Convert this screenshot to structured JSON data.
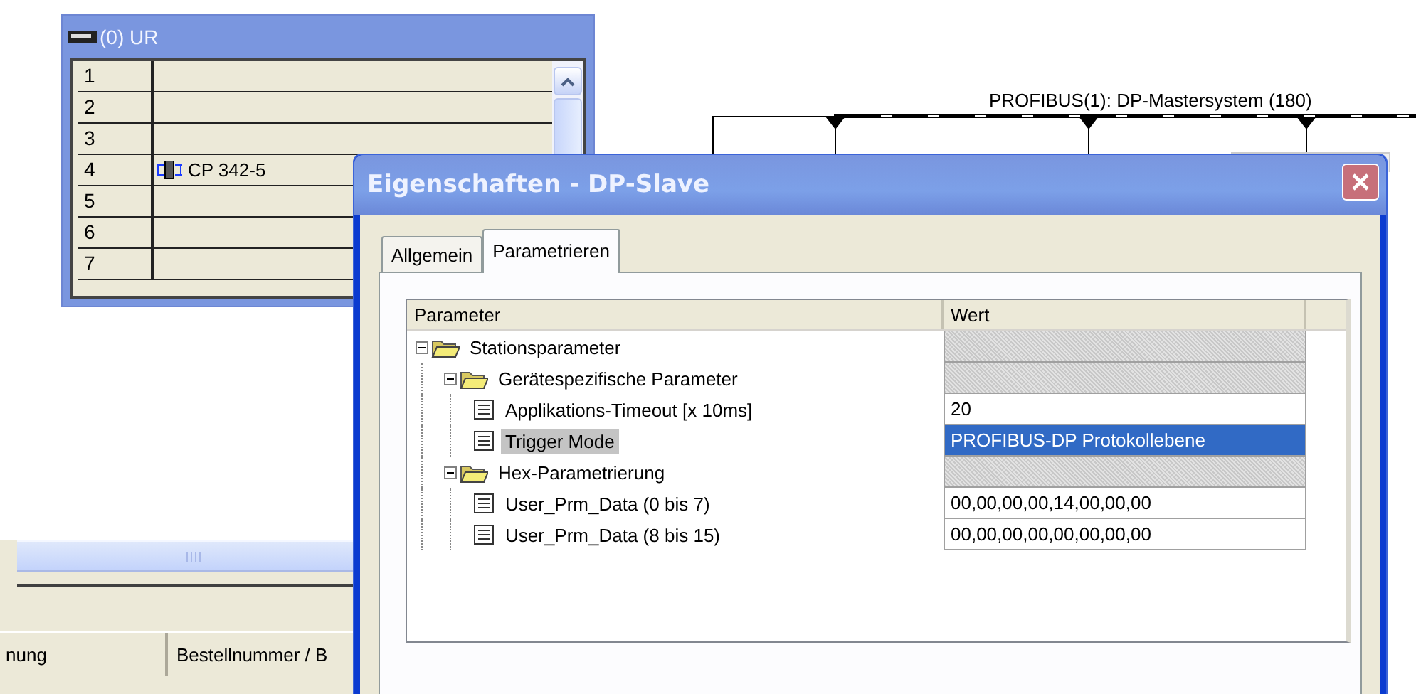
{
  "rack": {
    "title": "(0) UR",
    "rows": [
      {
        "slot": "1"
      },
      {
        "slot": "2"
      },
      {
        "slot": "3"
      },
      {
        "slot": "4",
        "module": "CP 342-5"
      },
      {
        "slot": "5"
      },
      {
        "slot": "6"
      },
      {
        "slot": "7"
      }
    ]
  },
  "bus": {
    "label": "PROFIBUS(1): DP-Mastersystem (180)"
  },
  "bottom_panel": {
    "columns": [
      "nung",
      "Bestellnummer / B"
    ]
  },
  "dialog": {
    "title": "Eigenschaften - DP-Slave",
    "tabs": [
      {
        "label": "Allgemein",
        "selected": false
      },
      {
        "label": "Parametrieren",
        "selected": true
      }
    ],
    "columns": [
      "Parameter",
      "Wert"
    ],
    "parameters": [
      {
        "name": "Stationsparameter",
        "expanded": true,
        "selected": false,
        "children": [
          {
            "name": "Gerätespezifische Parameter",
            "expanded": true,
            "selected": false,
            "children": [
              {
                "name": "Applikations-Timeout [x 10ms]",
                "value": "20",
                "selected": false
              },
              {
                "name": "Trigger Mode",
                "value": "PROFIBUS-DP Protokollebene",
                "selected": true
              }
            ]
          },
          {
            "name": "Hex-Parametrierung",
            "expanded": true,
            "selected": false,
            "children": [
              {
                "name": "User_Prm_Data (0 bis 7)",
                "value": "00,00,00,00,14,00,00,00",
                "selected": false
              },
              {
                "name": "User_Prm_Data (8 bis 15)",
                "value": "00,00,00,00,00,00,00,00",
                "selected": false
              }
            ]
          }
        ]
      }
    ]
  }
}
